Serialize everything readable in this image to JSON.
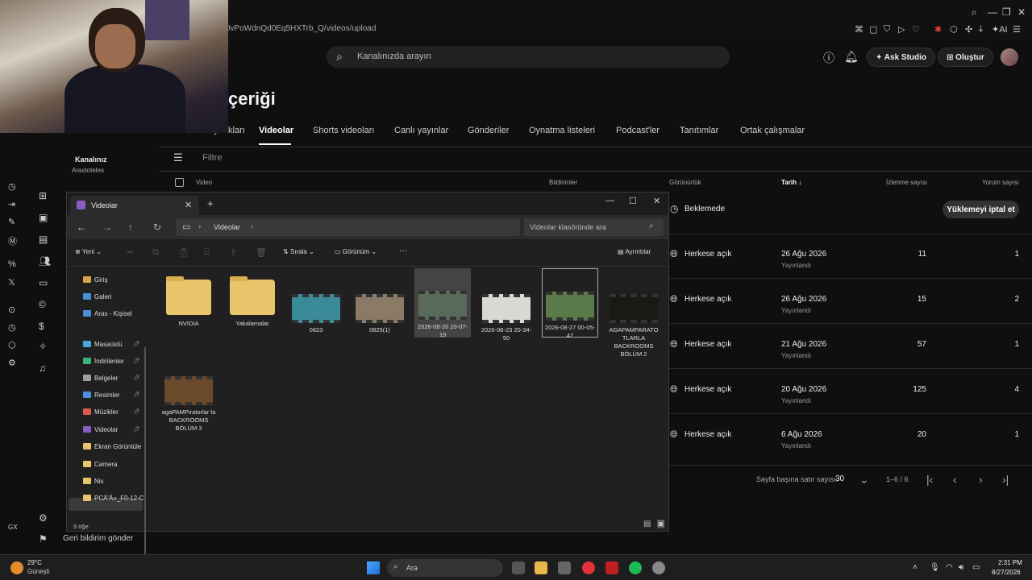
{
  "browser": {
    "url": "0vPoWdnQd0Eq5HXTrb_Q/videos/upload",
    "toolbar_ai": "AI"
  },
  "studio": {
    "search_placeholder": "Kanalınızda arayın",
    "ask_studio": "Ask Studio",
    "create": "Oluştur",
    "page_title": "çeriği",
    "channel_name": "Kanalınız",
    "channel_sub": "Arastoteles",
    "tabs": [
      "...ınları kaynakları",
      "Videolar",
      "Shorts videoları",
      "Canlı yayınlar",
      "Gönderiler",
      "Oynatma listeleri",
      "Podcast'ler",
      "Tanıtımlar",
      "Ortak çalışmalar"
    ],
    "filter_label": "Filtre",
    "columns": {
      "video": "Video",
      "notifications": "Bildirimler",
      "visibility": "Görünürlük",
      "date": "Tarih",
      "views": "İzlenme sayısı",
      "comments": "Yorum sayısı"
    },
    "cancel_upload": "Yüklemeyi iptal et",
    "rows": [
      {
        "visibility": "Beklemede",
        "date": "",
        "date_sub": "",
        "views": "",
        "comments": ""
      },
      {
        "visibility": "Herkese açık",
        "date": "26 Ağu 2026",
        "date_sub": "Yayınlandı",
        "views": "11",
        "comments": "1"
      },
      {
        "visibility": "Herkese açık",
        "date": "26 Ağu 2026",
        "date_sub": "Yayınlandı",
        "views": "15",
        "comments": "2"
      },
      {
        "visibility": "Herkese açık",
        "date": "21 Ağu 2026",
        "date_sub": "Yayınlandı",
        "views": "57",
        "comments": "1"
      },
      {
        "visibility": "Herkese açık",
        "date": "20 Ağu 2026",
        "date_sub": "Yayınlandı",
        "views": "125",
        "comments": "4"
      },
      {
        "visibility": "Herkese açık",
        "date": "6 Ağu 2026",
        "date_sub": "Yayınlandı",
        "views": "20",
        "comments": "1"
      }
    ],
    "rows_per_page_label": "Sayfa başına satır sayısı:",
    "rows_per_page": "30",
    "range": "1–6 / 6",
    "feedback": "Geri bildirim gönder",
    "gx": "GX"
  },
  "explorer": {
    "tab_title": "Videolar",
    "breadcrumb": "Videolar",
    "search_placeholder": "Videolar klasöründe ara",
    "new": "Yeni",
    "sort": "Sırala",
    "view": "Görünüm",
    "more": "···",
    "details": "Ayrıntılar",
    "sidebar": [
      {
        "label": "Giriş",
        "color": "#d9a54a",
        "pin": false
      },
      {
        "label": "Galeri",
        "color": "#4a90d9",
        "pin": false
      },
      {
        "label": "Aras - Kişisel",
        "color": "#4a90d9",
        "pin": false
      },
      {
        "label": "Masaüstü",
        "color": "#4aa3d9",
        "pin": true
      },
      {
        "label": "İndirilenler",
        "color": "#3bb37a",
        "pin": true
      },
      {
        "label": "Belgeler",
        "color": "#a0a0a0",
        "pin": true
      },
      {
        "label": "Resimler",
        "color": "#4a90d9",
        "pin": true
      },
      {
        "label": "Müzikler",
        "color": "#d95a4a",
        "pin": true
      },
      {
        "label": "Videolar",
        "color": "#8a5cc6",
        "pin": true
      },
      {
        "label": "Ekran Görüntüle",
        "color": "#e8c46a",
        "pin": false
      },
      {
        "label": "Camera",
        "color": "#e8c46a",
        "pin": false
      },
      {
        "label": "Nis",
        "color": "#e8c46a",
        "pin": false
      },
      {
        "label": "PCÃ'Ã»_F0-12-C",
        "color": "#e8c46a",
        "pin": false
      }
    ],
    "items": [
      {
        "name": "NVIDIA",
        "kind": "folder"
      },
      {
        "name": "Yakalamalar",
        "kind": "folder"
      },
      {
        "name": "0823",
        "kind": "video",
        "color": "#3a8a9a"
      },
      {
        "name": "0825(1)",
        "kind": "video",
        "color": "#8a7a66"
      },
      {
        "name": "2026-08-20 20-07-19",
        "kind": "video",
        "color": "#5a6a5a"
      },
      {
        "name": "2026-08-23 20-34-50",
        "kind": "video",
        "color": "#d8d8d4"
      },
      {
        "name": "2026-08-27 00-05-47",
        "kind": "video",
        "color": "#5a7a4a"
      },
      {
        "name": "AGAPAMPARATO TLARLA BACKROOMS BÖLÜM 2",
        "kind": "video",
        "color": "#1a1a14"
      },
      {
        "name": "agaPAMPiratorlar la BACKROOMS BÖLÜM 3",
        "kind": "video",
        "color": "#6a4a2a"
      }
    ],
    "status": "9 öğe"
  },
  "taskbar": {
    "temp": "29°C",
    "weather": "Güneşli",
    "search": "Ara",
    "time": "2:31 PM",
    "date": "8/27/2026"
  }
}
